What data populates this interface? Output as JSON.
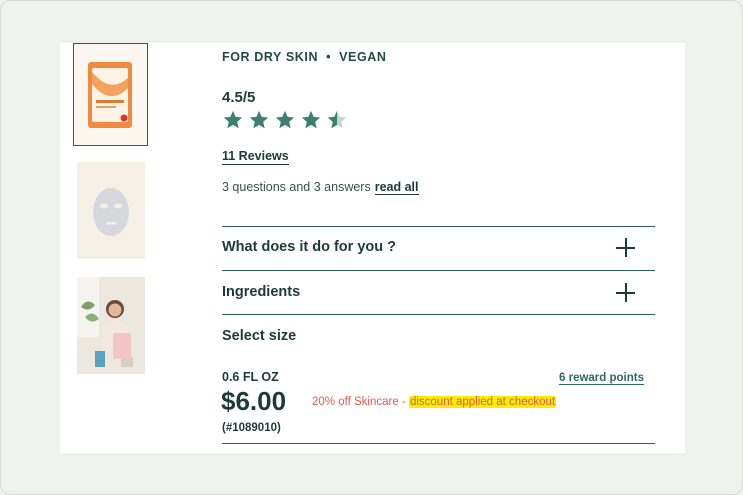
{
  "product": {
    "tags": [
      "FOR DRY SKIN",
      "VEGAN"
    ],
    "tag_separator": "•",
    "rating_text": "4.5/5",
    "rating_value": 4.5,
    "rating_max": 5,
    "reviews_link": "11 Reviews",
    "qa_text": "3 questions and 3 answers",
    "qa_link": "read all"
  },
  "accordion": [
    {
      "label": "What does it do for you ?"
    },
    {
      "label": "Ingredients"
    }
  ],
  "size": {
    "title": "Select size",
    "option_label": "0.6 FL OZ",
    "reward_points": "6 reward points",
    "price": "$6.00",
    "promo_prefix": "20% off Skincare - ",
    "promo_highlight": "discount applied at checkout",
    "sku": "(#1089010)"
  },
  "colors": {
    "brand": "#1c3b35",
    "star": "#3d7f73",
    "promo": "#e25a4d",
    "highlight": "#f6f000"
  },
  "icons": [
    "star-icon",
    "plus-icon"
  ]
}
